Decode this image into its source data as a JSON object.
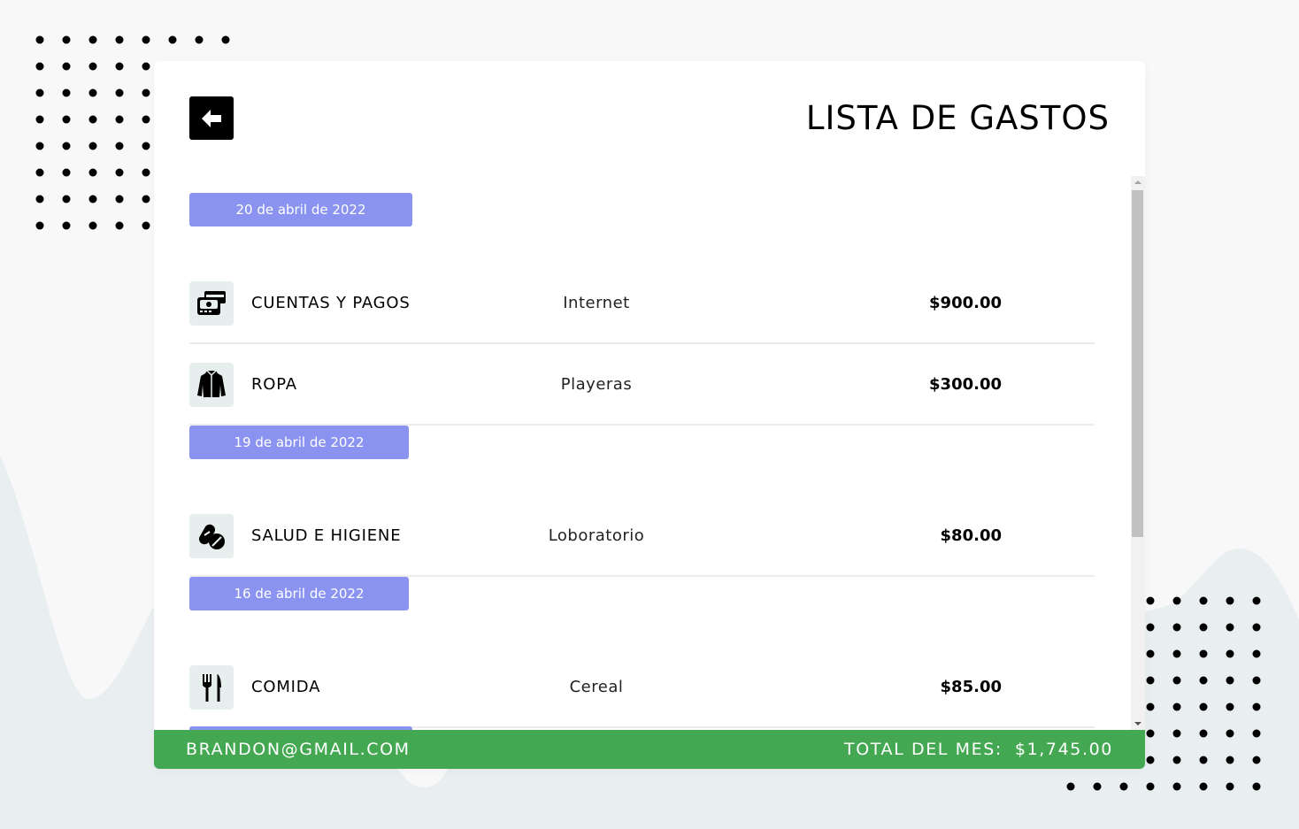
{
  "header": {
    "title": "LISTA DE GASTOS",
    "back_icon": "arrow-left-icon"
  },
  "groups": [
    {
      "date": "20 de abril de 2022",
      "items": [
        {
          "category": "CUENTAS Y PAGOS",
          "description": "Internet",
          "amount": "$900.00",
          "icon": "bills-payments-icon"
        },
        {
          "category": "ROPA",
          "description": "Playeras",
          "amount": "$300.00",
          "icon": "jacket-icon"
        }
      ]
    },
    {
      "date": "19 de abril de 2022",
      "items": [
        {
          "category": "SALUD E HIGIENE",
          "description": "Loboratorio",
          "amount": "$80.00",
          "icon": "pills-icon"
        }
      ]
    },
    {
      "date": "16 de abril de 2022",
      "items": [
        {
          "category": "COMIDA",
          "description": "Cereal",
          "amount": "$85.00",
          "icon": "fork-knife-icon"
        }
      ]
    }
  ],
  "footer": {
    "email": "BRANDON@GMAIL.COM",
    "total_label": "TOTAL DEL MES:",
    "total_value": "$1,745.00"
  },
  "colors": {
    "date_badge": "#8a93ef",
    "footer": "#44a752",
    "icon_bg": "#e7eeee"
  }
}
